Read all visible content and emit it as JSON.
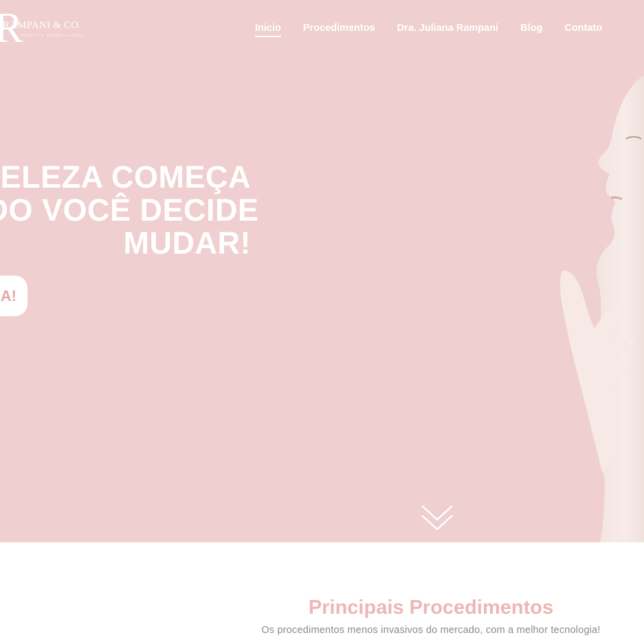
{
  "logo": {
    "monogram": "R",
    "brand": "RAMPANI & CO.",
    "tagline": "ESTÉTICA ESPECIALIZADA"
  },
  "nav": {
    "items": [
      {
        "label": "Inicio",
        "active": true
      },
      {
        "label": "Procedimentos",
        "active": false
      },
      {
        "label": "Dra. Juliana Rampani",
        "active": false
      },
      {
        "label": "Blog",
        "active": false
      },
      {
        "label": "Contato",
        "active": false
      }
    ]
  },
  "hero": {
    "headline_lines": [
      "A BELEZA COMEÇA",
      "QUANDO VOCÊ DECIDE",
      "MUDAR!"
    ],
    "cta_label": "A!",
    "colors": {
      "background": "#efcfcf",
      "text": "#ffffff",
      "accent": "#e8a7a7"
    },
    "scroll_icon": "double-chevron-down-icon"
  },
  "procedures": {
    "title": "Principais Procedimentos",
    "subtitle": "Os procedimentos menos invasivos do mercado, com a melhor tecnologia!"
  }
}
